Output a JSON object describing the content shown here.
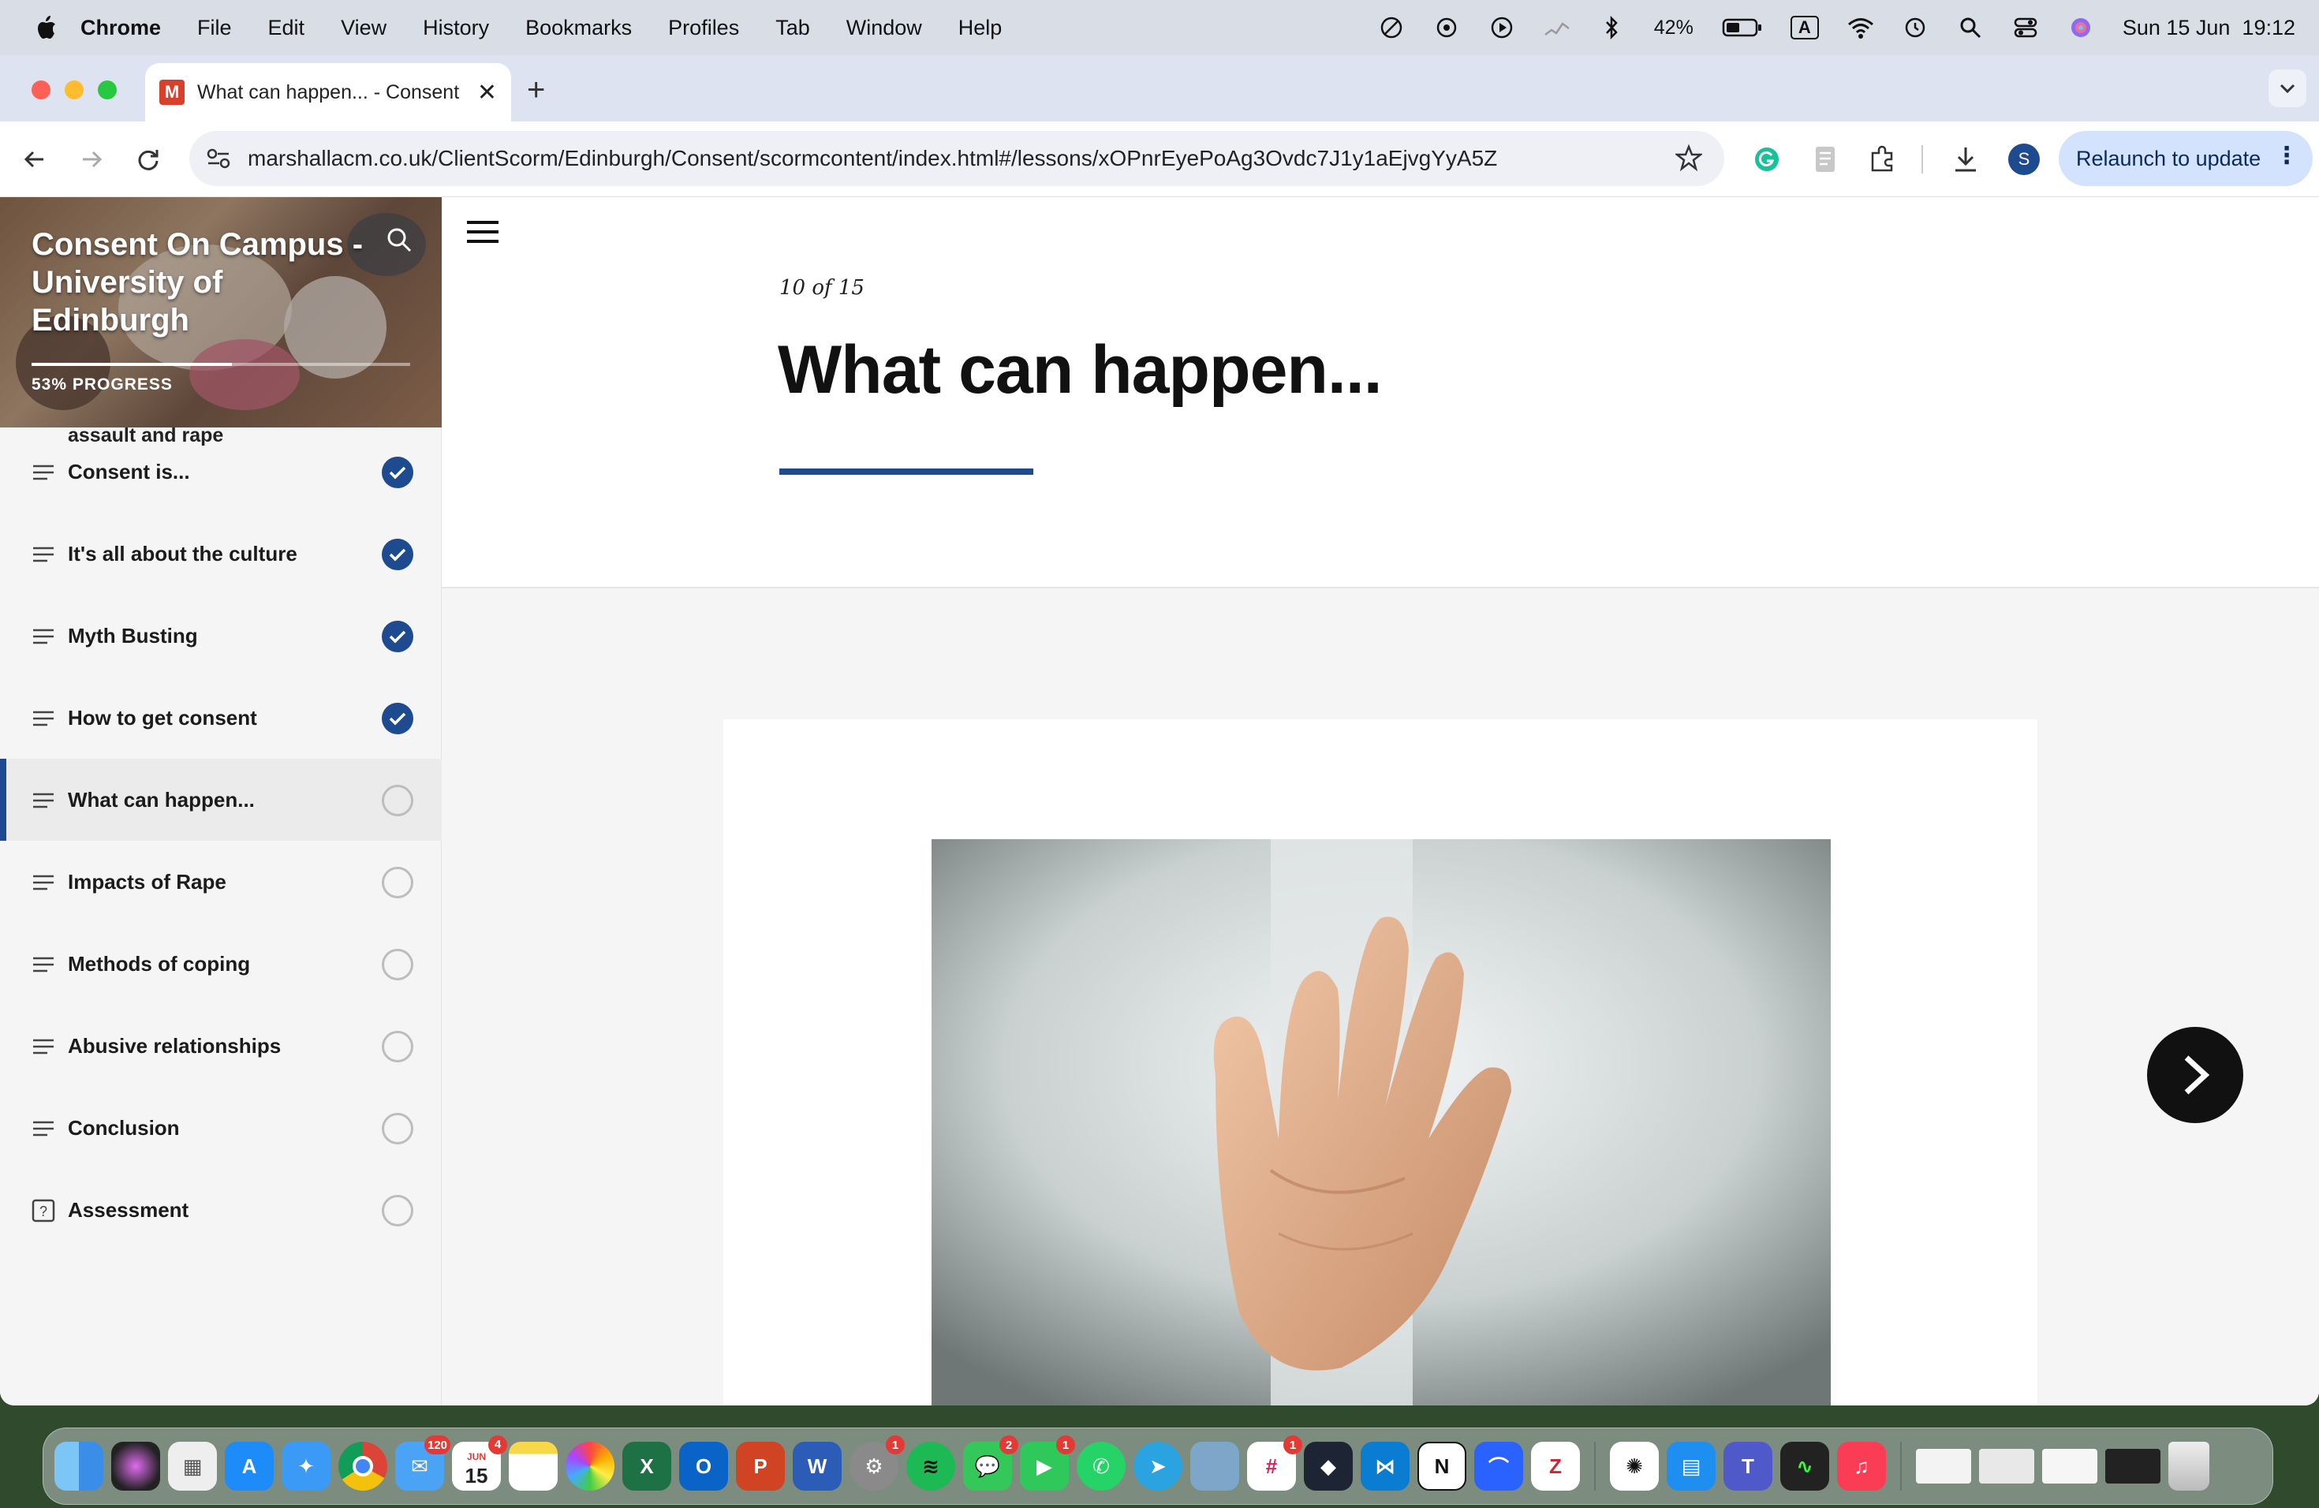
{
  "menubar": {
    "app_name": "Chrome",
    "menus": [
      "File",
      "Edit",
      "View",
      "History",
      "Bookmarks",
      "Profiles",
      "Tab",
      "Window",
      "Help"
    ],
    "battery": "42%",
    "input_source": "A",
    "datetime": "Sun 15 Jun  19:12"
  },
  "browser": {
    "tab_title": "What can happen... - Consent",
    "tab_favicon": "M",
    "url": "marshallacm.co.uk/ClientScorm/Edinburgh/Consent/scormcontent/index.html#/lessons/xOPnrEyePoAg3Ovdc7J1y1aEjvgYyA5Z",
    "profile_initial": "S",
    "relaunch_label": "Relaunch to update"
  },
  "course": {
    "title": "Consent On Campus - University of Edinburgh",
    "progress_percent": 53,
    "progress_label": "53% PROGRESS",
    "partial_item": "assault and rape",
    "lessons": [
      {
        "label": "Consent is...",
        "status": "complete",
        "icon": "lines-icon"
      },
      {
        "label": "It's all about the culture",
        "status": "complete",
        "icon": "lines-icon"
      },
      {
        "label": "Myth Busting",
        "status": "complete",
        "icon": "lines-icon"
      },
      {
        "label": "How to get consent",
        "status": "complete",
        "icon": "lines-icon"
      },
      {
        "label": "What can happen...",
        "status": "incomplete",
        "icon": "lines-icon",
        "active": true
      },
      {
        "label": "Impacts of Rape",
        "status": "incomplete",
        "icon": "lines-icon"
      },
      {
        "label": "Methods of coping",
        "status": "incomplete",
        "icon": "lines-icon"
      },
      {
        "label": "Abusive relationships",
        "status": "incomplete",
        "icon": "lines-icon"
      },
      {
        "label": "Conclusion",
        "status": "incomplete",
        "icon": "lines-icon"
      },
      {
        "label": "Assessment",
        "status": "incomplete",
        "icon": "question-icon"
      }
    ]
  },
  "lesson": {
    "counter": "10 of 15",
    "title": "What can happen..."
  },
  "colors": {
    "accent": "#1e4b8f",
    "relaunch_bg": "#d3e3fd"
  },
  "dock": {
    "badges": {
      "mail": "120",
      "calendar": "4",
      "settings": "1",
      "messages": "2",
      "facetime": "1",
      "slack": "1"
    },
    "calendar_month": "JUN",
    "calendar_day": "15"
  }
}
